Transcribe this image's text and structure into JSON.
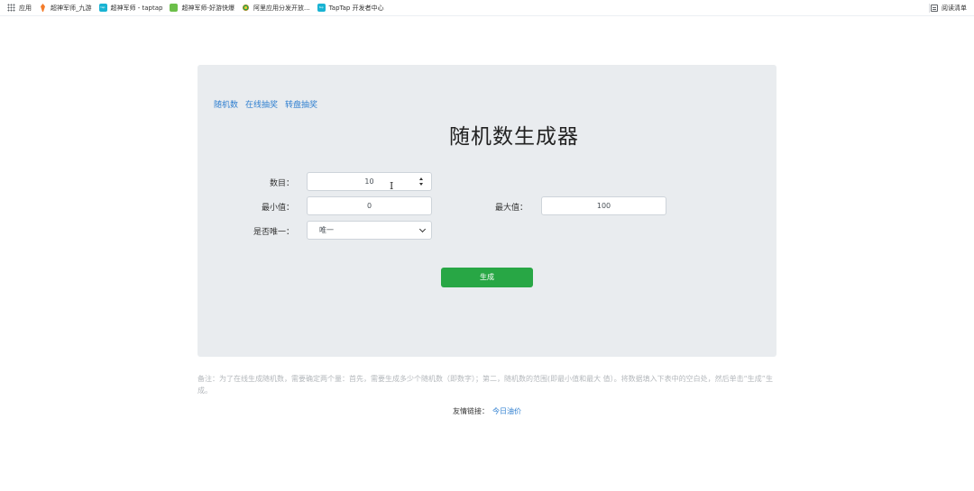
{
  "bookmarks": {
    "items": [
      {
        "label": "应用",
        "icon": "apps-grid-icon"
      },
      {
        "label": "超神军师_九游",
        "icon": "jiuyou-icon"
      },
      {
        "label": "超神军师 - taptap",
        "icon": "taptap-icon"
      },
      {
        "label": "超神军师-好游快爆",
        "icon": "haoyou-icon"
      },
      {
        "label": "阿里应用分发开放...",
        "icon": "aliyun-icon"
      },
      {
        "label": "TapTap 开发者中心",
        "icon": "taptap-icon"
      }
    ],
    "reading_mode": "阅读清单"
  },
  "nav": {
    "links": [
      "随机数",
      "在线抽奖",
      "转盘抽奖"
    ]
  },
  "form": {
    "title": "随机数生成器",
    "count_label": "数目：",
    "count_value": "10",
    "min_label": "最小值：",
    "min_value": "0",
    "max_label": "最大值：",
    "max_value": "100",
    "unique_label": "是否唯一：",
    "unique_value": "唯一",
    "generate_label": "生成"
  },
  "footer": {
    "note": "备注：为了在线生成随机数，需要确定两个量：首先，需要生成多少个随机数（即数字）；第二，随机数的范围(即最小值和最大 值）。将数据填入下表中的空白处，然后单击“生成”生成。",
    "friend_links_label": "友情链接：",
    "friend_link": "今日油价"
  },
  "colors": {
    "panel_bg": "#e9ecef",
    "link": "#2f7fd0",
    "button": "#28a745"
  }
}
